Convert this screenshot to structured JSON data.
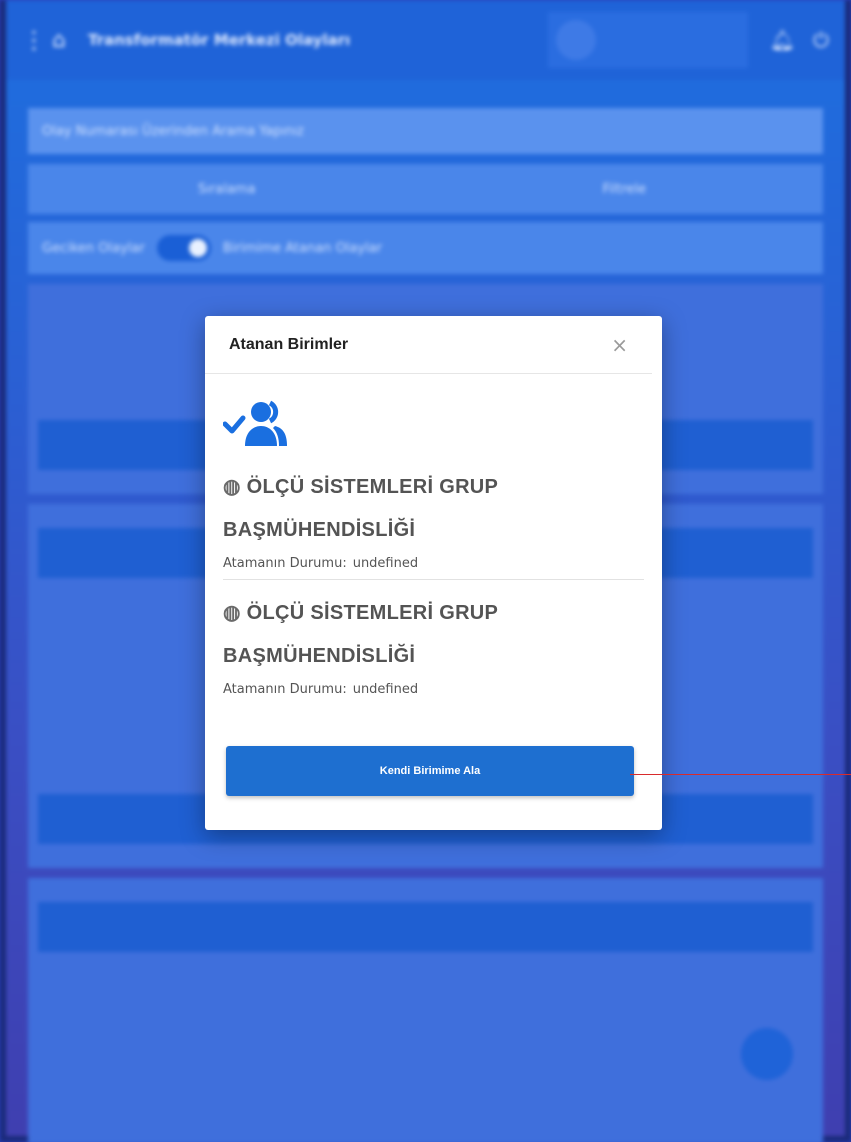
{
  "background": {
    "app_title": "Transformatör Merkezi Olayları",
    "search_placeholder": "Olay Numarası Üzerinden Arama Yapınız",
    "sort_label": "Sıralama",
    "filter_label": "Filtrele",
    "toggle_left_label": "Geciken Olaylar",
    "toggle_right_label": "Birimime Atanan Olaylar"
  },
  "modal": {
    "title": "Atanan Birimler",
    "close_glyph": "×",
    "units": [
      {
        "name_line1": "ÖLÇÜ SİSTEMLERİ GRUP",
        "name_line2": "BAŞMÜHENDİSLİĞİ",
        "status_label": "Atamanın Durumu:",
        "status_value": "undefined"
      },
      {
        "name_line1": "ÖLÇÜ SİSTEMLERİ GRUP",
        "name_line2": "BAŞMÜHENDİSLİĞİ",
        "status_label": "Atamanın Durumu:",
        "status_value": "undefined"
      }
    ],
    "claim_button_label": "Kendi Birimime Ala"
  },
  "colors": {
    "accent": "#1e6fd0",
    "icon_blue": "#1a6fe0",
    "annotation": "#d92b2b"
  },
  "icons": {
    "people_check": "users-check-icon",
    "globe": "globe-icon"
  }
}
